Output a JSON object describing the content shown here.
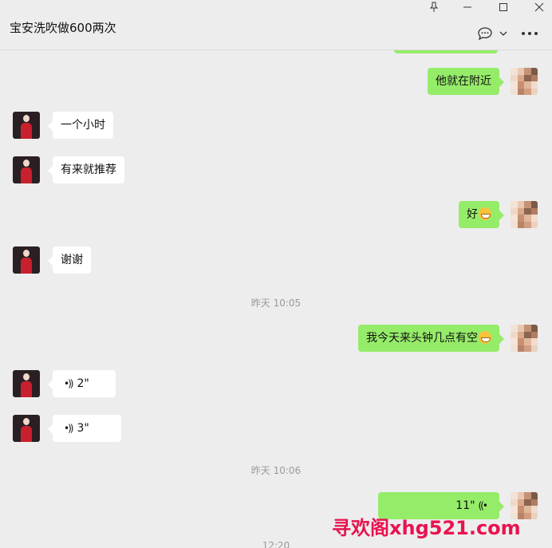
{
  "window": {
    "pin_icon": "pin-icon",
    "minimize_icon": "minimize-icon",
    "maximize_icon": "maximize-icon",
    "close_icon": "close-icon"
  },
  "header": {
    "title": "宝安洗吹做600两次",
    "chat_menu_icon": "chat-bubble-icon",
    "more_icon": "more-dots-icon"
  },
  "messages": [
    {
      "from": "me",
      "type": "text",
      "text": "他就在附近"
    },
    {
      "from": "them",
      "type": "text",
      "text": "一个小时"
    },
    {
      "from": "them",
      "type": "text",
      "text": "有来就推荐"
    },
    {
      "from": "me",
      "type": "text",
      "text": "好",
      "emoji": "grin-emoji"
    },
    {
      "from": "them",
      "type": "text",
      "text": "谢谢"
    },
    {
      "type": "time",
      "text": "昨天 10:05"
    },
    {
      "from": "me",
      "type": "text",
      "text": "我今天来头钟几点有空",
      "emoji": "grin-emoji"
    },
    {
      "from": "them",
      "type": "voice",
      "duration": "2\""
    },
    {
      "from": "them",
      "type": "voice",
      "duration": "3\""
    },
    {
      "type": "time",
      "text": "昨天 10:06"
    },
    {
      "from": "me",
      "type": "voice",
      "duration": "11\""
    },
    {
      "type": "time",
      "text": "12:20"
    }
  ],
  "watermark": "寻欢阁xhg521.com",
  "colors": {
    "background": "#ededed",
    "my_bubble": "#95ec69",
    "their_bubble": "#ffffff",
    "watermark": "#e8134f"
  }
}
